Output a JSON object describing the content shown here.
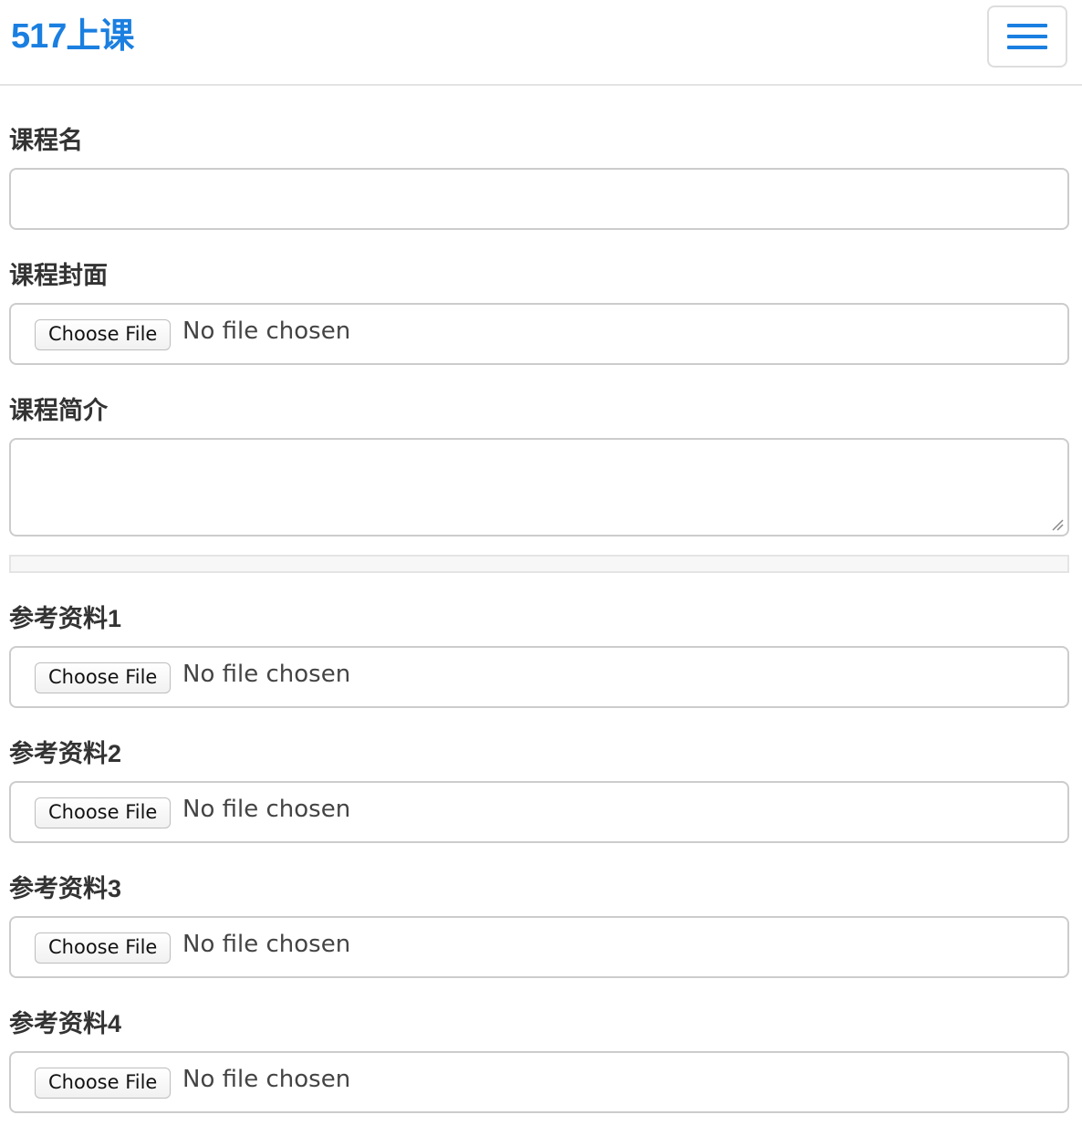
{
  "navbar": {
    "brand": "517上课",
    "menu_icon": "hamburger-menu-icon"
  },
  "form": {
    "course_name": {
      "label": "课程名",
      "value": ""
    },
    "course_cover": {
      "label": "课程封面",
      "button_label": "Choose File",
      "status": "No file chosen"
    },
    "course_intro": {
      "label": "课程简介",
      "value": ""
    },
    "upload_progress": {
      "fraction": 0
    },
    "references": [
      {
        "label": "参考资料1",
        "button_label": "Choose File",
        "status": "No file chosen"
      },
      {
        "label": "参考资料2",
        "button_label": "Choose File",
        "status": "No file chosen"
      },
      {
        "label": "参考资料3",
        "button_label": "Choose File",
        "status": "No file chosen"
      },
      {
        "label": "参考资料4",
        "button_label": "Choose File",
        "status": "No file chosen"
      }
    ]
  },
  "colors": {
    "accent": "#1a7fe0",
    "border": "#cccccc",
    "label_text": "#333333"
  }
}
